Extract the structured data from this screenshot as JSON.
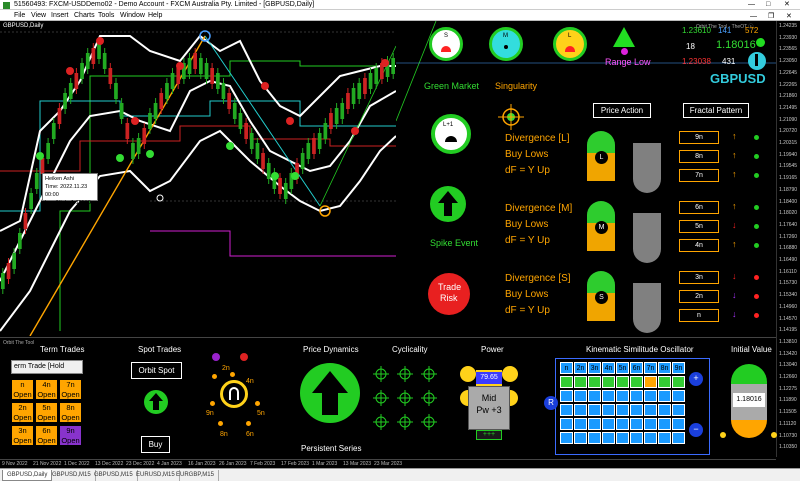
{
  "window": {
    "title": "51560493: FXCM-USDDemo02 - Demo Account - FXCM Australia Pty. Limited - [GBPUSD,Daily]",
    "menu": [
      "File",
      "View",
      "Insert",
      "Charts",
      "Tools",
      "Window",
      "Help"
    ]
  },
  "chart": {
    "label": "GBPUSD,Daily",
    "overlay_label": "Orbit The Tool - TheOT ⓒ",
    "tooltip": {
      "line1": "Heiken Ashi",
      "line2": "Time: 2022.11.23 00:00",
      "line3": "Low/High: 1.18560"
    },
    "price_scale": [
      "1.24235",
      "1.23930",
      "1.23565",
      "1.23050",
      "1.22645",
      "1.22265",
      "1.21860",
      "1.21495",
      "1.21090",
      "1.20720",
      "1.20315",
      "1.19940",
      "1.19545",
      "1.19165",
      "1.18790",
      "1.18400",
      "1.18020",
      "1.17640",
      "1.17260",
      "1.16880",
      "1.16490",
      "1.16110",
      "1.15730",
      "1.15340",
      "1.14960",
      "1.14570",
      "1.14195",
      "1.13810",
      "1.13420",
      "1.13040",
      "1.12660",
      "1.12275",
      "1.11890",
      "1.11505",
      "1.11120",
      "1.10730",
      "1.10350"
    ],
    "dates": [
      "9 Nov 2022",
      "21 Nov 2022",
      "1 Dec 2022",
      "13 Dec 2022",
      "23 Dec 2022",
      "4 Jan 2023",
      "16 Jan 2023",
      "26 Jan 2023",
      "7 Feb 2023",
      "17 Feb 2023",
      "1 Mar 2023",
      "13 Mar 2023",
      "23 Mar 2023"
    ]
  },
  "orbit": {
    "circle_s": "S",
    "circle_m": "M",
    "circle_l": "L",
    "circle_l1": "L+1",
    "quote_bid": "1.23610",
    "quote_spread": "141",
    "quote_extra": "572",
    "quote_digits": "18",
    "quote_last": "1.18016",
    "quote_low": "1.23038",
    "quote_count": "431",
    "symbol": "GBPUSD",
    "range": "Range Low",
    "green_market": "Green Market",
    "singularity": "Singularity",
    "price_action": "Price Action",
    "fractal_pattern": "Fractal Pattern",
    "spike_event": "Spike Event",
    "trade_risk_1": "Trade",
    "trade_risk_2": "Risk",
    "divergences": [
      {
        "title": "Divergence [L]",
        "line2": "Buy Lows",
        "line3": "dF = Y Up",
        "coin": "L",
        "rows": [
          {
            "label": "9n",
            "arrow": "↑",
            "arrow_color": "#ffa500",
            "dot": "#22cc22"
          },
          {
            "label": "8n",
            "arrow": "↑",
            "arrow_color": "#ffa500",
            "dot": "#22cc22"
          },
          {
            "label": "7n",
            "arrow": "↑",
            "arrow_color": "#ffa500",
            "dot": "#22cc22"
          }
        ]
      },
      {
        "title": "Divergence [M]",
        "line2": "Buy Lows",
        "line3": "dF = Y Up",
        "coin": "M",
        "rows": [
          {
            "label": "6n",
            "arrow": "↑",
            "arrow_color": "#ffa500",
            "dot": "#22cc22"
          },
          {
            "label": "5n",
            "arrow": "↓",
            "arrow_color": "#ff2222",
            "dot": "#22cc22"
          },
          {
            "label": "4n",
            "arrow": "↑",
            "arrow_color": "#ffa500",
            "dot": "#22cc22"
          }
        ]
      },
      {
        "title": "Divergence [S]",
        "line2": "Buy Lows",
        "line3": "dF = Y Up",
        "coin": "S",
        "rows": [
          {
            "label": "3n",
            "arrow": "↓",
            "arrow_color": "#ff2222",
            "dot": "#ff2222"
          },
          {
            "label": "2n",
            "arrow": "↓",
            "arrow_color": "#aa33ff",
            "dot": "#ff2222"
          },
          {
            "label": "n",
            "arrow": "↓",
            "arrow_color": "#aa33ff",
            "dot": "#ff2222"
          }
        ]
      }
    ]
  },
  "bottom": {
    "tool_label": "Orbit The Tool",
    "term_trades": "Term Trades",
    "term_trade_select": "erm Trade [Hold",
    "term_cells": [
      {
        "n": "n",
        "s": "Open",
        "c": "#ffa500"
      },
      {
        "n": "4n",
        "s": "Open",
        "c": "#ffa500"
      },
      {
        "n": "7n",
        "s": "Open",
        "c": "#ffa500"
      },
      {
        "n": "2n",
        "s": "Open",
        "c": "#ffa500"
      },
      {
        "n": "5n",
        "s": "Open",
        "c": "#ffa500"
      },
      {
        "n": "8n",
        "s": "Open",
        "c": "#ffa500"
      },
      {
        "n": "3n",
        "s": "Open",
        "c": "#ffa500"
      },
      {
        "n": "6n",
        "s": "Open",
        "c": "#ffa500"
      },
      {
        "n": "9n",
        "s": "Open",
        "c": "#8833cc"
      }
    ],
    "spot_trades": "Spot Trades",
    "orbit_spot": "Orbit Spot",
    "buy": "Buy",
    "wheel": {
      "2n": "2n",
      "4n": "4n",
      "5n": "5n",
      "6n": "6n",
      "8n": "8n",
      "9n": "9n",
      "n": "n"
    },
    "price_dynamics": "Price Dynamics",
    "persistent_series": "Persistent Series",
    "cyclicality": "Cyclicality",
    "power": "Power",
    "power_value": "79.65",
    "power_mid": "Mid",
    "power_pw": "Pw +3",
    "power_bottom": "+++",
    "kso_title": "Kinematic Similitude Oscillator",
    "kso_headers": [
      "n",
      "2n",
      "3n",
      "4n",
      "5n",
      "6n",
      "7n",
      "8n",
      "9n"
    ],
    "kso_row_colors": [
      "#33cc33",
      "#33cc33",
      "#33cc33",
      "#33cc33",
      "#33cc33",
      "#33cc33",
      "#ffa500",
      "#33cc33",
      "#33cc33"
    ],
    "kso_plus": "+",
    "kso_minus": "−",
    "kso_r": "R",
    "initial_value": "Initial Value",
    "initial_value_num": "1.18016"
  },
  "tabs": [
    "GBPUSD,Daily",
    "GBPUSD,M15",
    "GBPUSD,M15",
    "EURUSD,M15",
    "EURGBP,M15"
  ]
}
